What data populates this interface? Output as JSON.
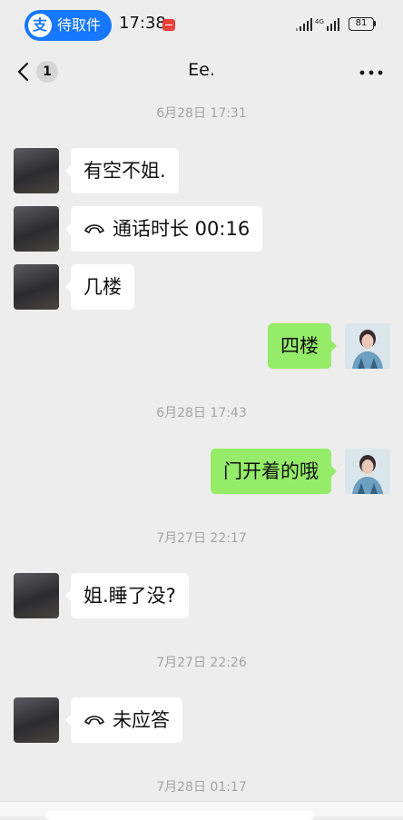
{
  "status_bar": {
    "alipay_logo": "支",
    "alipay_label": "待取件",
    "time": "17:38",
    "network": "4G",
    "battery": "81"
  },
  "header": {
    "unread_count": "1",
    "title": "Ee."
  },
  "messages": [
    {
      "type": "timestamp",
      "text": "6月28日 17:31"
    },
    {
      "type": "text",
      "from": "contact",
      "text": "有空不姐."
    },
    {
      "type": "call",
      "from": "contact",
      "text": "通话时长 00:16"
    },
    {
      "type": "text",
      "from": "contact",
      "text": "几楼"
    },
    {
      "type": "text",
      "from": "self",
      "text": "四楼"
    },
    {
      "type": "timestamp",
      "text": "6月28日 17:43"
    },
    {
      "type": "text",
      "from": "self",
      "text": "门开着的哦"
    },
    {
      "type": "timestamp",
      "text": "7月27日 22:17"
    },
    {
      "type": "text",
      "from": "contact",
      "text": "姐.睡了没?"
    },
    {
      "type": "timestamp",
      "text": "7月27日 22:26"
    },
    {
      "type": "call",
      "from": "contact",
      "text": "未应答"
    },
    {
      "type": "timestamp",
      "text": "7月28日 01:17"
    }
  ],
  "colors": {
    "background": "#ededed",
    "bubble_in": "#ffffff",
    "bubble_out": "#95ec69",
    "alipay_blue": "#1677ff"
  }
}
